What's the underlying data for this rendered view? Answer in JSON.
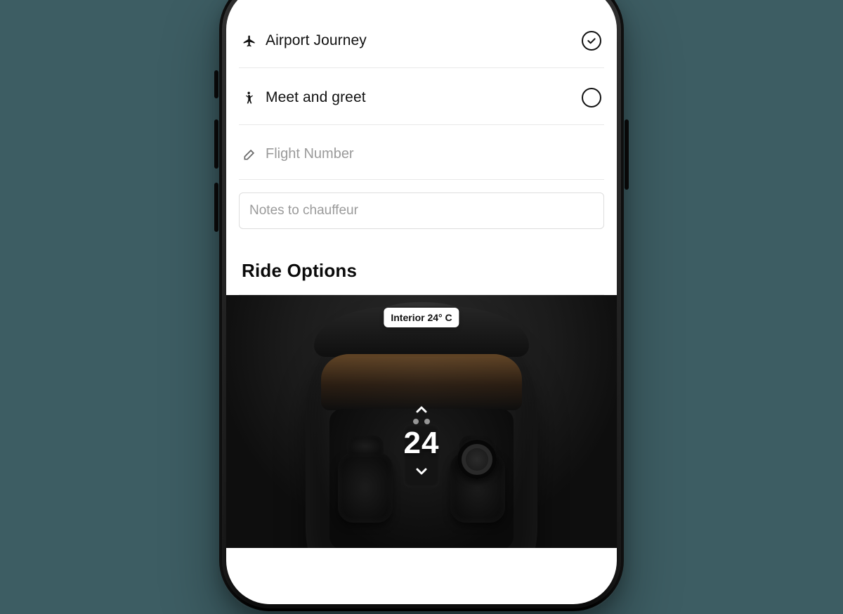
{
  "options": {
    "airport": {
      "label": "Airport Journey",
      "checked": true
    },
    "meet_greet": {
      "label": "Meet and greet",
      "checked": false
    }
  },
  "fields": {
    "flight_number": {
      "placeholder": "Flight Number",
      "value": ""
    },
    "notes": {
      "placeholder": "Notes to chauffeur",
      "value": ""
    }
  },
  "sections": {
    "ride_options": {
      "title": "Ride Options"
    }
  },
  "ride": {
    "interior_badge": "Interior 24° C",
    "temperature_value": "24"
  }
}
